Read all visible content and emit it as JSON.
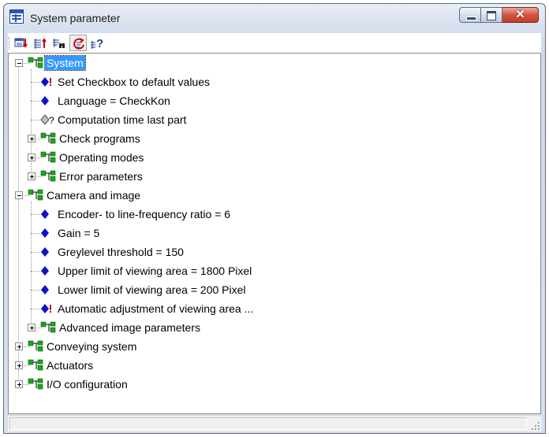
{
  "window": {
    "title": "System parameter"
  },
  "toolbar": {
    "buttons": [
      {
        "icon": "save-to-device-icon"
      },
      {
        "icon": "upload-icon"
      },
      {
        "icon": "find-icon"
      },
      {
        "icon": "reset-icon"
      },
      {
        "icon": "help-icon"
      }
    ]
  },
  "tree": {
    "items": [
      {
        "label": "System",
        "kind": "folder",
        "expanded": true,
        "selected": true
      },
      {
        "label": "Set Checkbox to default values",
        "kind": "action"
      },
      {
        "label": "Language = CheckKon",
        "kind": "param"
      },
      {
        "label": "Computation time last part",
        "kind": "readonly"
      },
      {
        "label": "Check programs",
        "kind": "folder",
        "expanded": false
      },
      {
        "label": "Operating modes",
        "kind": "folder",
        "expanded": false
      },
      {
        "label": "Error parameters",
        "kind": "folder",
        "expanded": false
      },
      {
        "label": "Camera and image",
        "kind": "folder",
        "expanded": true
      },
      {
        "label": "Encoder- to line-frequency ratio = 6",
        "kind": "param"
      },
      {
        "label": "Gain = 5",
        "kind": "param"
      },
      {
        "label": "Greylevel threshold = 150",
        "kind": "param"
      },
      {
        "label": "Upper limit of viewing area = 1800 Pixel",
        "kind": "param"
      },
      {
        "label": "Lower limit of viewing area = 200 Pixel",
        "kind": "param"
      },
      {
        "label": "Automatic adjustment of viewing area ...",
        "kind": "action"
      },
      {
        "label": "Advanced image parameters",
        "kind": "folder",
        "expanded": false
      },
      {
        "label": "Conveying system",
        "kind": "folder",
        "expanded": false
      },
      {
        "label": "Actuators",
        "kind": "folder",
        "expanded": false
      },
      {
        "label": "I/O configuration",
        "kind": "folder",
        "expanded": false
      }
    ]
  },
  "colors": {
    "selection": "#3399ff",
    "param_icon": "#1010c8",
    "folder_icon": "#18a818",
    "action_mark": "#cc0000"
  }
}
